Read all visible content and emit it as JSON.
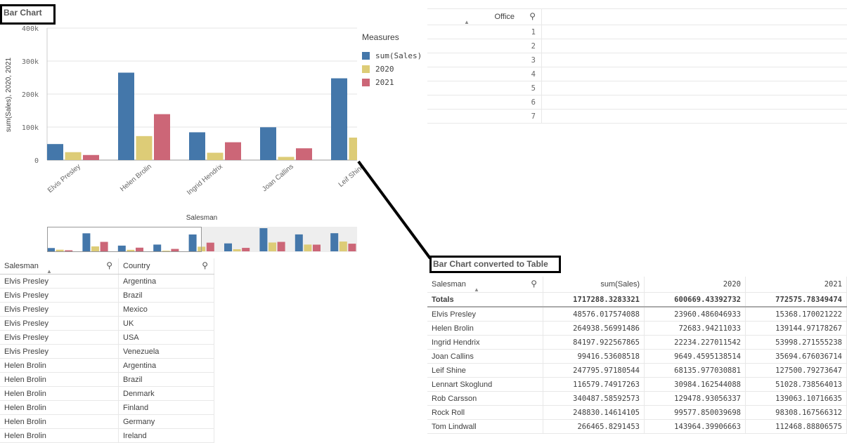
{
  "bar_chart": {
    "title": "Bar Chart",
    "legend_title": "Measures"
  },
  "chart_data": {
    "type": "bar",
    "title": "Bar Chart",
    "xlabel": "Salesman",
    "ylabel": "sum(Sales), 2020, 2021",
    "ylim": [
      0,
      400000
    ],
    "yticks": [
      "0",
      "100k",
      "200k",
      "300k",
      "400k"
    ],
    "categories": [
      "Elvis Presley",
      "Helen Brolin",
      "Ingrid Hendrix",
      "Joan Callins",
      "Leif Shine",
      "Lennart Skoglund",
      "Rob Carsson",
      "Rock Roll",
      "Tom Lindwall"
    ],
    "visible_categories": 5,
    "series": [
      {
        "name": "sum(Sales)",
        "color": "#4477aa",
        "values": [
          48576.02,
          264938.57,
          84197.92,
          99416.54,
          247795.97,
          116579.75,
          340487.59,
          248830.15,
          266465.83
        ]
      },
      {
        "name": "2020",
        "color": "#ddcc77",
        "values": [
          23960.49,
          72683.94,
          22234.23,
          9649.46,
          68135.98,
          30984.16,
          129478.93,
          99577.85,
          143964.4
        ]
      },
      {
        "name": "2021",
        "color": "#cc6677",
        "values": [
          15368.17,
          139144.97,
          53998.27,
          35694.68,
          127500.79,
          51028.74,
          139063.11,
          98308.17,
          112468.89
        ]
      }
    ],
    "legend": "right",
    "grid": true
  },
  "office_table": {
    "header": "Office",
    "rows": [
      "1",
      "2",
      "3",
      "4",
      "5",
      "6",
      "7"
    ]
  },
  "left_table": {
    "headers": [
      "Salesman",
      "Country"
    ],
    "rows": [
      [
        "Elvis Presley",
        "Argentina"
      ],
      [
        "Elvis Presley",
        "Brazil"
      ],
      [
        "Elvis Presley",
        "Mexico"
      ],
      [
        "Elvis Presley",
        "UK"
      ],
      [
        "Elvis Presley",
        "USA"
      ],
      [
        "Elvis Presley",
        "Venezuela"
      ],
      [
        "Helen Brolin",
        "Argentina"
      ],
      [
        "Helen Brolin",
        "Brazil"
      ],
      [
        "Helen Brolin",
        "Denmark"
      ],
      [
        "Helen Brolin",
        "Finland"
      ],
      [
        "Helen Brolin",
        "Germany"
      ],
      [
        "Helen Brolin",
        "Ireland"
      ]
    ]
  },
  "converted": {
    "title": "Bar Chart converted to Table",
    "headers": [
      "Salesman",
      "sum(Sales)",
      "2020",
      "2021"
    ],
    "totals": [
      "Totals",
      "1717288.3283321",
      "600669.43392732",
      "772575.78349474"
    ],
    "rows": [
      [
        "Elvis Presley",
        "48576.017574088",
        "23960.486046933",
        "15368.170021222"
      ],
      [
        "Helen Brolin",
        "264938.56991486",
        "72683.94211033",
        "139144.97178267"
      ],
      [
        "Ingrid Hendrix",
        "84197.922567865",
        "22234.227011542",
        "53998.271555238"
      ],
      [
        "Joan Callins",
        "99416.53608518",
        "9649.4595138514",
        "35694.676036714"
      ],
      [
        "Leif Shine",
        "247795.97180544",
        "68135.977030881",
        "127500.79273647"
      ],
      [
        "Lennart Skoglund",
        "116579.74917263",
        "30984.162544088",
        "51028.738564013"
      ],
      [
        "Rob Carsson",
        "340487.58592573",
        "129478.93056337",
        "139063.10716635"
      ],
      [
        "Rock Roll",
        "248830.14614105",
        "99577.850039698",
        "98308.167566312"
      ],
      [
        "Tom Lindwall",
        "266465.8291453",
        "143964.39906663",
        "112468.88806575"
      ]
    ]
  }
}
